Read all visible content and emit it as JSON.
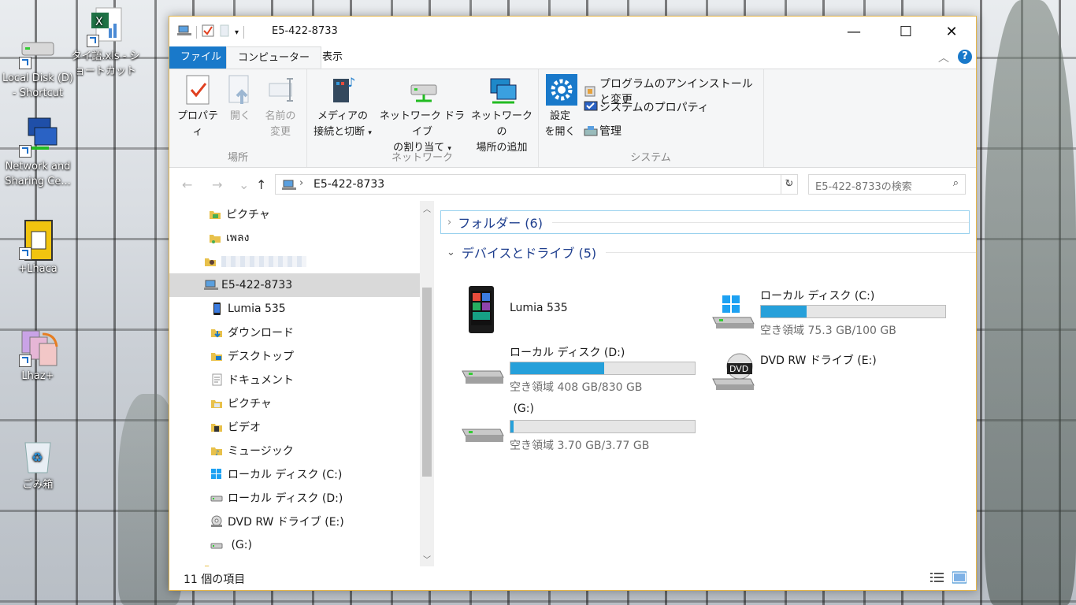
{
  "desktop": {
    "icons": [
      {
        "label": "Local Disk (D) - Shortcut",
        "icon": "drive-icon"
      },
      {
        "label": "タイ語.xls - ショートカット",
        "icon": "excel-icon"
      },
      {
        "label": "Network and Sharing Ce...",
        "icon": "network-icon"
      },
      {
        "label": "+Lhaca",
        "icon": "archiver-icon"
      },
      {
        "label": "Lhaz+",
        "icon": "archiver-icon"
      },
      {
        "label": "ごみ箱",
        "icon": "recycle-bin-icon"
      }
    ]
  },
  "window": {
    "title": "E5-422-8733",
    "controls": {
      "minimize": "—",
      "maximize": "☐",
      "close": "✕"
    },
    "tabs": {
      "file": "ファイル",
      "computer": "コンピューター",
      "view": "表示"
    },
    "help": "?"
  },
  "ribbon": {
    "groups": {
      "location": {
        "label": "場所",
        "properties": "プロパティ",
        "open": "開く",
        "rename_1": "名前の",
        "rename_2": "変更"
      },
      "network": {
        "label": "ネットワーク",
        "media_1": "メディアの",
        "media_2": "接続と切断",
        "map_1": "ネットワーク ドライブ",
        "map_2": "の割り当て",
        "add_1": "ネットワークの",
        "add_2": "場所の追加"
      },
      "system": {
        "label": "システム",
        "settings_1": "設定",
        "settings_2": "を開く",
        "uninstall": "プログラムのアンインストールと変更",
        "sysprops": "システムのプロパティ",
        "manage": "管理"
      }
    }
  },
  "address": {
    "path": "E5-422-8733",
    "search_placeholder": "E5-422-8733の検索"
  },
  "nav": {
    "items": [
      {
        "label": "ピクチャ",
        "icon": "pictures-folder-icon"
      },
      {
        "label": "เพลง",
        "icon": "music-folder-icon"
      },
      {
        "label": "",
        "icon": "user-folder-icon"
      },
      {
        "label": "E5-422-8733",
        "icon": "computer-icon",
        "selected": true
      },
      {
        "label": "Lumia 535",
        "icon": "phone-icon"
      },
      {
        "label": "ダウンロード",
        "icon": "downloads-folder-icon"
      },
      {
        "label": "デスクトップ",
        "icon": "desktop-folder-icon"
      },
      {
        "label": "ドキュメント",
        "icon": "documents-folder-icon"
      },
      {
        "label": "ピクチャ",
        "icon": "pictures-folder-icon"
      },
      {
        "label": "ビデオ",
        "icon": "videos-folder-icon"
      },
      {
        "label": "ミュージック",
        "icon": "music-folder-icon"
      },
      {
        "label": "ローカル ディスク (C:)",
        "icon": "windows-drive-icon"
      },
      {
        "label": "ローカル ディスク (D:)",
        "icon": "drive-icon"
      },
      {
        "label": "DVD RW ドライブ (E:)",
        "icon": "dvd-drive-icon"
      },
      {
        "label": " (G:)",
        "icon": "drive-icon"
      }
    ]
  },
  "content": {
    "folders_header": "フォルダー (6)",
    "devices_header": "デバイスとドライブ (5)",
    "devices": [
      {
        "name": "Lumia 535",
        "icon": "phone-icon"
      },
      {
        "name": "ローカル ディスク (C:)",
        "free": "空き領域 75.3 GB/100 GB",
        "used_fraction": 0.247,
        "icon": "windows-drive-icon"
      },
      {
        "name": "ローカル ディスク (D:)",
        "free": "空き領域 408 GB/830 GB",
        "used_fraction": 0.508,
        "icon": "drive-icon"
      },
      {
        "name": "DVD RW ドライブ (E:)",
        "icon": "dvd-drive-icon",
        "badge": "DVD"
      },
      {
        "name": " (G:)",
        "free": "空き領域 3.70 GB/3.77 GB",
        "used_fraction": 0.019,
        "icon": "drive-icon"
      }
    ]
  },
  "status": {
    "count": "11 個の項目"
  },
  "colors": {
    "accent": "#1979ca",
    "bar_fill": "#26a0da",
    "header_text": "#1e3e8e"
  }
}
